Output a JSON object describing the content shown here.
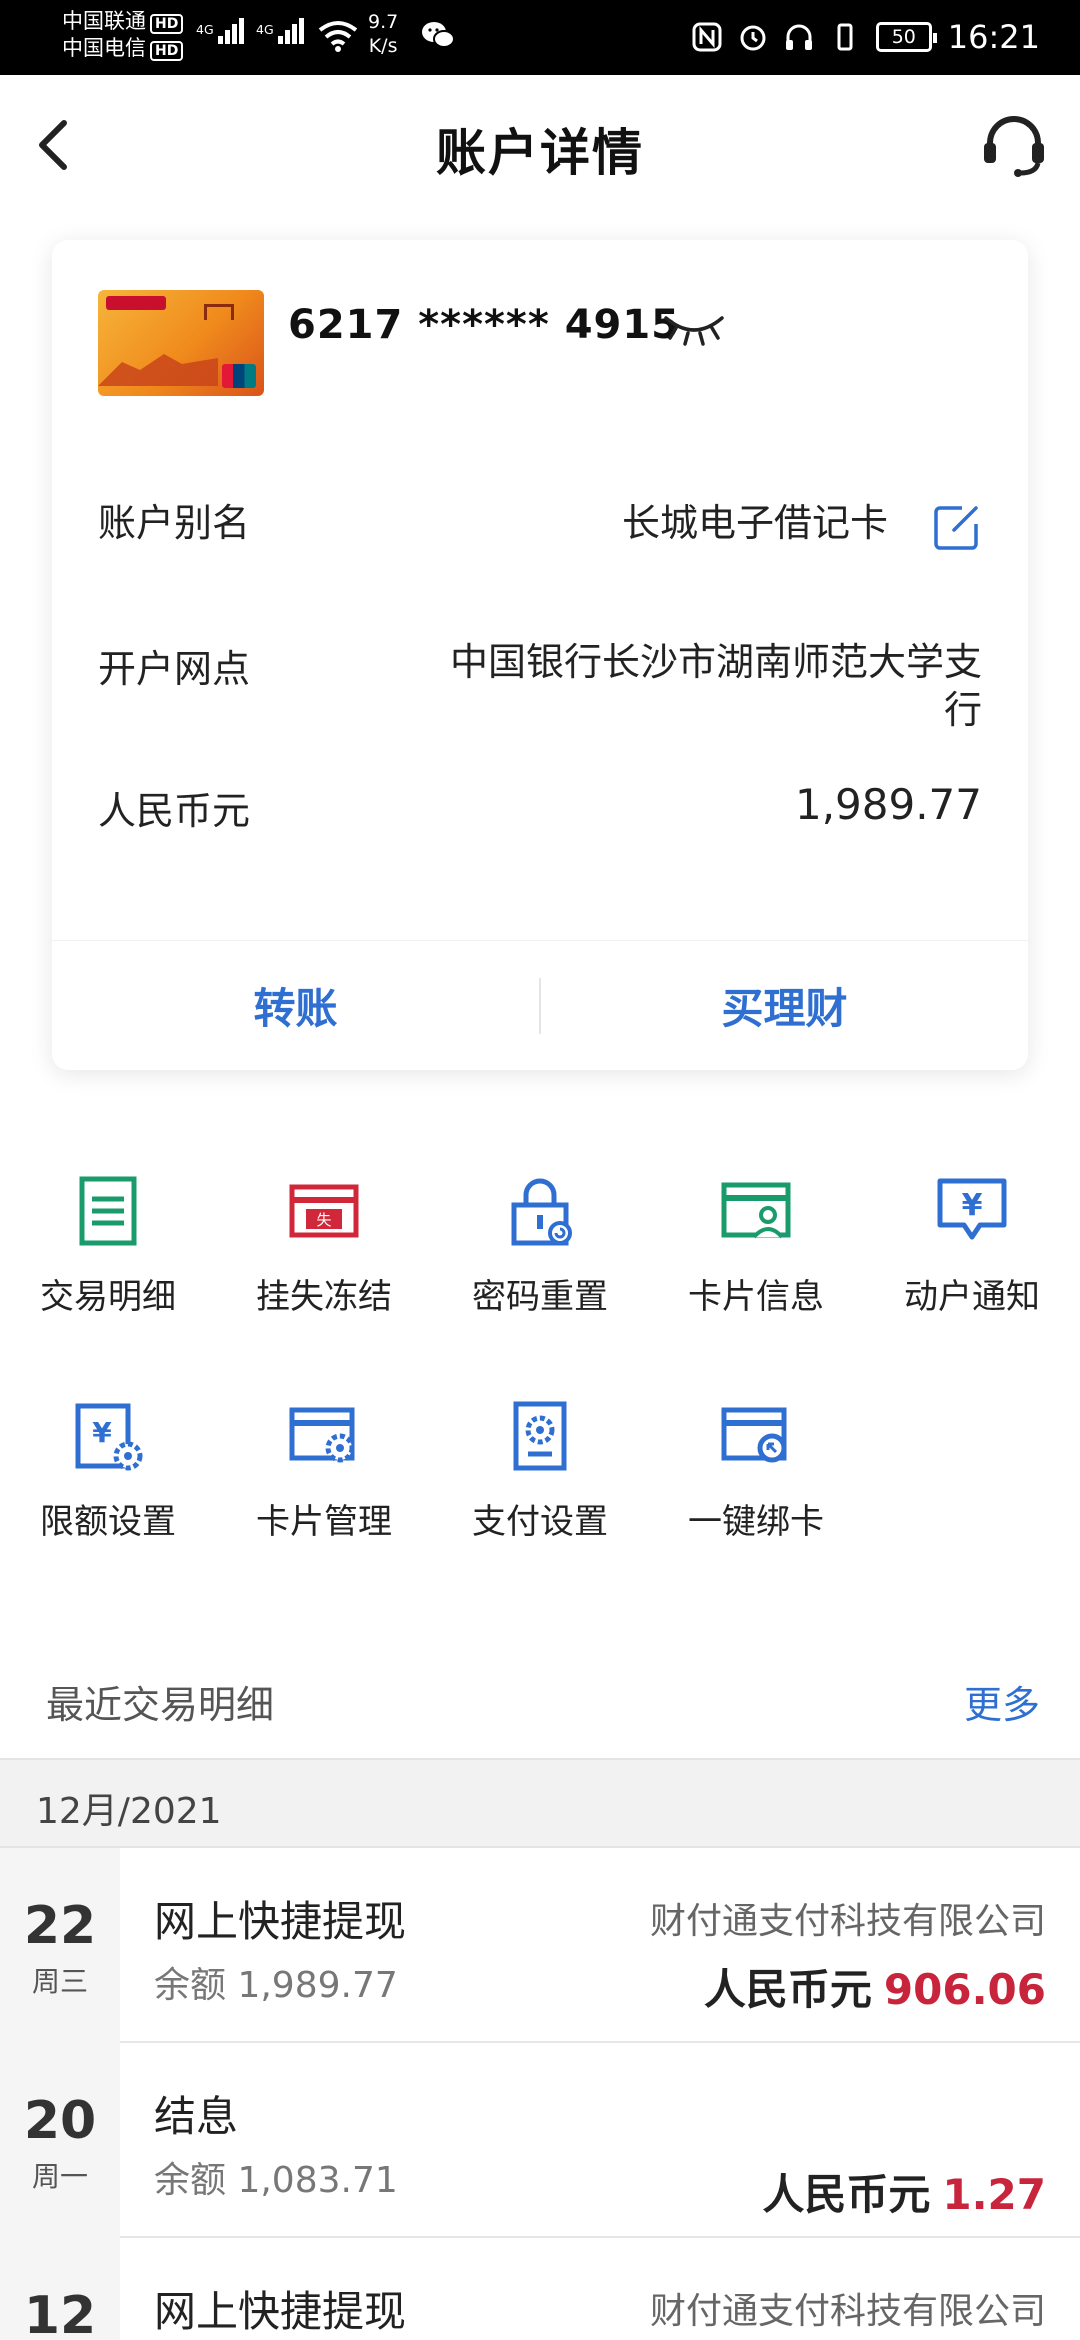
{
  "status_bar": {
    "carrier1": "中国联通",
    "carrier2": "中国电信",
    "hd": "HD",
    "net1": "4G",
    "net2": "4G",
    "speed_value": "9.7",
    "speed_unit": "K/s",
    "battery": "50",
    "time": "16:21"
  },
  "header": {
    "title": "账户详情"
  },
  "card": {
    "number": "6217 ****** 4915",
    "alias_label": "账户别名",
    "alias_value": "长城电子借记卡",
    "branch_label": "开户网点",
    "branch_value": "中国银行长沙市湖南师范大学支行",
    "currency_label": "人民币元",
    "balance": "1,989.77",
    "action_transfer": "转账",
    "action_wealth": "买理财"
  },
  "functions": [
    {
      "label": "交易明细",
      "icon": "list-icon",
      "color": "#1a9b6c"
    },
    {
      "label": "挂失冻结",
      "icon": "lost-card-icon",
      "color": "#d0283a"
    },
    {
      "label": "密码重置",
      "icon": "lock-reset-icon",
      "color": "#2f6fd1"
    },
    {
      "label": "卡片信息",
      "icon": "card-user-icon",
      "color": "#1a9b6c"
    },
    {
      "label": "动户通知",
      "icon": "yen-message-icon",
      "color": "#2f6fd1"
    },
    {
      "label": "限额设置",
      "icon": "yen-settings-icon",
      "color": "#2f6fd1"
    },
    {
      "label": "卡片管理",
      "icon": "card-gear-icon",
      "color": "#2f6fd1"
    },
    {
      "label": "支付设置",
      "icon": "payment-settings-icon",
      "color": "#2f6fd1"
    },
    {
      "label": "一键绑卡",
      "icon": "bind-card-icon",
      "color": "#2f6fd1"
    }
  ],
  "lost_badge": "失",
  "yen": "¥",
  "recent": {
    "title": "最近交易明细",
    "more": "更多",
    "month": "12月/2021",
    "transactions": [
      {
        "day": "22",
        "weekday": "周三",
        "title": "网上快捷提现",
        "balance": "余额 1,989.77",
        "party": "财付通支付科技有限公司",
        "currency": "人民币元",
        "amount": "906.06"
      },
      {
        "day": "20",
        "weekday": "周一",
        "title": "结息",
        "balance": "余额 1,083.71",
        "party": "",
        "currency": "人民币元",
        "amount": "1.27"
      },
      {
        "day": "12",
        "weekday": "",
        "title": "网上快捷提现",
        "balance": "",
        "party": "财付通支付科技有限公司",
        "currency": "",
        "amount": ""
      }
    ]
  }
}
